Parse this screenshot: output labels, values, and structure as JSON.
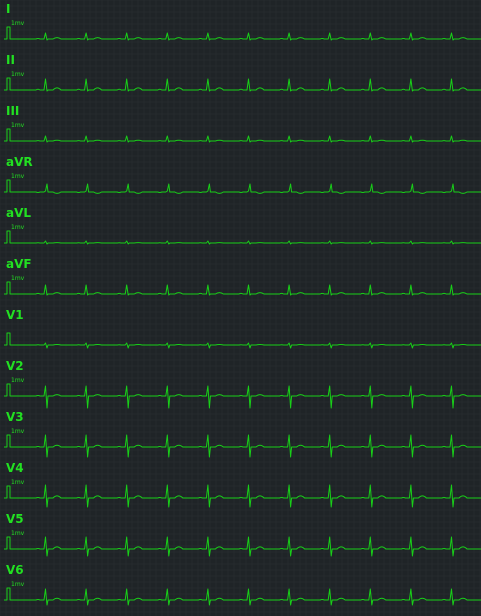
{
  "colors": {
    "background": "#1f2427",
    "grid": "#2a3033",
    "trace": "#18d018"
  },
  "calibration_label": "1mv",
  "leads": [
    {
      "id": "I",
      "label": "I",
      "r": 6,
      "q": 0,
      "s": 1,
      "t": 2,
      "p": 1
    },
    {
      "id": "II",
      "label": "II",
      "r": 11,
      "q": 0,
      "s": 1,
      "t": 3,
      "p": 1.5
    },
    {
      "id": "III",
      "label": "III",
      "r": 5,
      "q": 0,
      "s": 1,
      "t": 1,
      "p": 0.8
    },
    {
      "id": "aVR",
      "label": "aVR",
      "r": 1,
      "q": 0,
      "s": -8,
      "t": -2,
      "p": -1
    },
    {
      "id": "aVL",
      "label": "aVL",
      "r": 2,
      "q": 0,
      "s": 1,
      "t": 0.5,
      "p": 0.4
    },
    {
      "id": "aVF",
      "label": "aVF",
      "r": 9,
      "q": 0,
      "s": 1,
      "t": 2,
      "p": 1.2
    },
    {
      "id": "V1",
      "label": "V1",
      "r": 2,
      "q": 0,
      "s": 3,
      "t": 0.8,
      "p": 0.5
    },
    {
      "id": "V2",
      "label": "V2",
      "r": 10,
      "q": 0,
      "s": 12,
      "t": 2,
      "p": 1
    },
    {
      "id": "V3",
      "label": "V3",
      "r": 12,
      "q": 0,
      "s": 10,
      "t": 2.5,
      "p": 1
    },
    {
      "id": "V4",
      "label": "V4",
      "r": 13,
      "q": 0,
      "s": 9,
      "t": 3,
      "p": 1
    },
    {
      "id": "V5",
      "label": "V5",
      "r": 12,
      "q": 0,
      "s": 7,
      "t": 3,
      "p": 1
    },
    {
      "id": "V6",
      "label": "V6",
      "r": 11,
      "q": 0,
      "s": 5,
      "t": 2.5,
      "p": 1
    }
  ]
}
